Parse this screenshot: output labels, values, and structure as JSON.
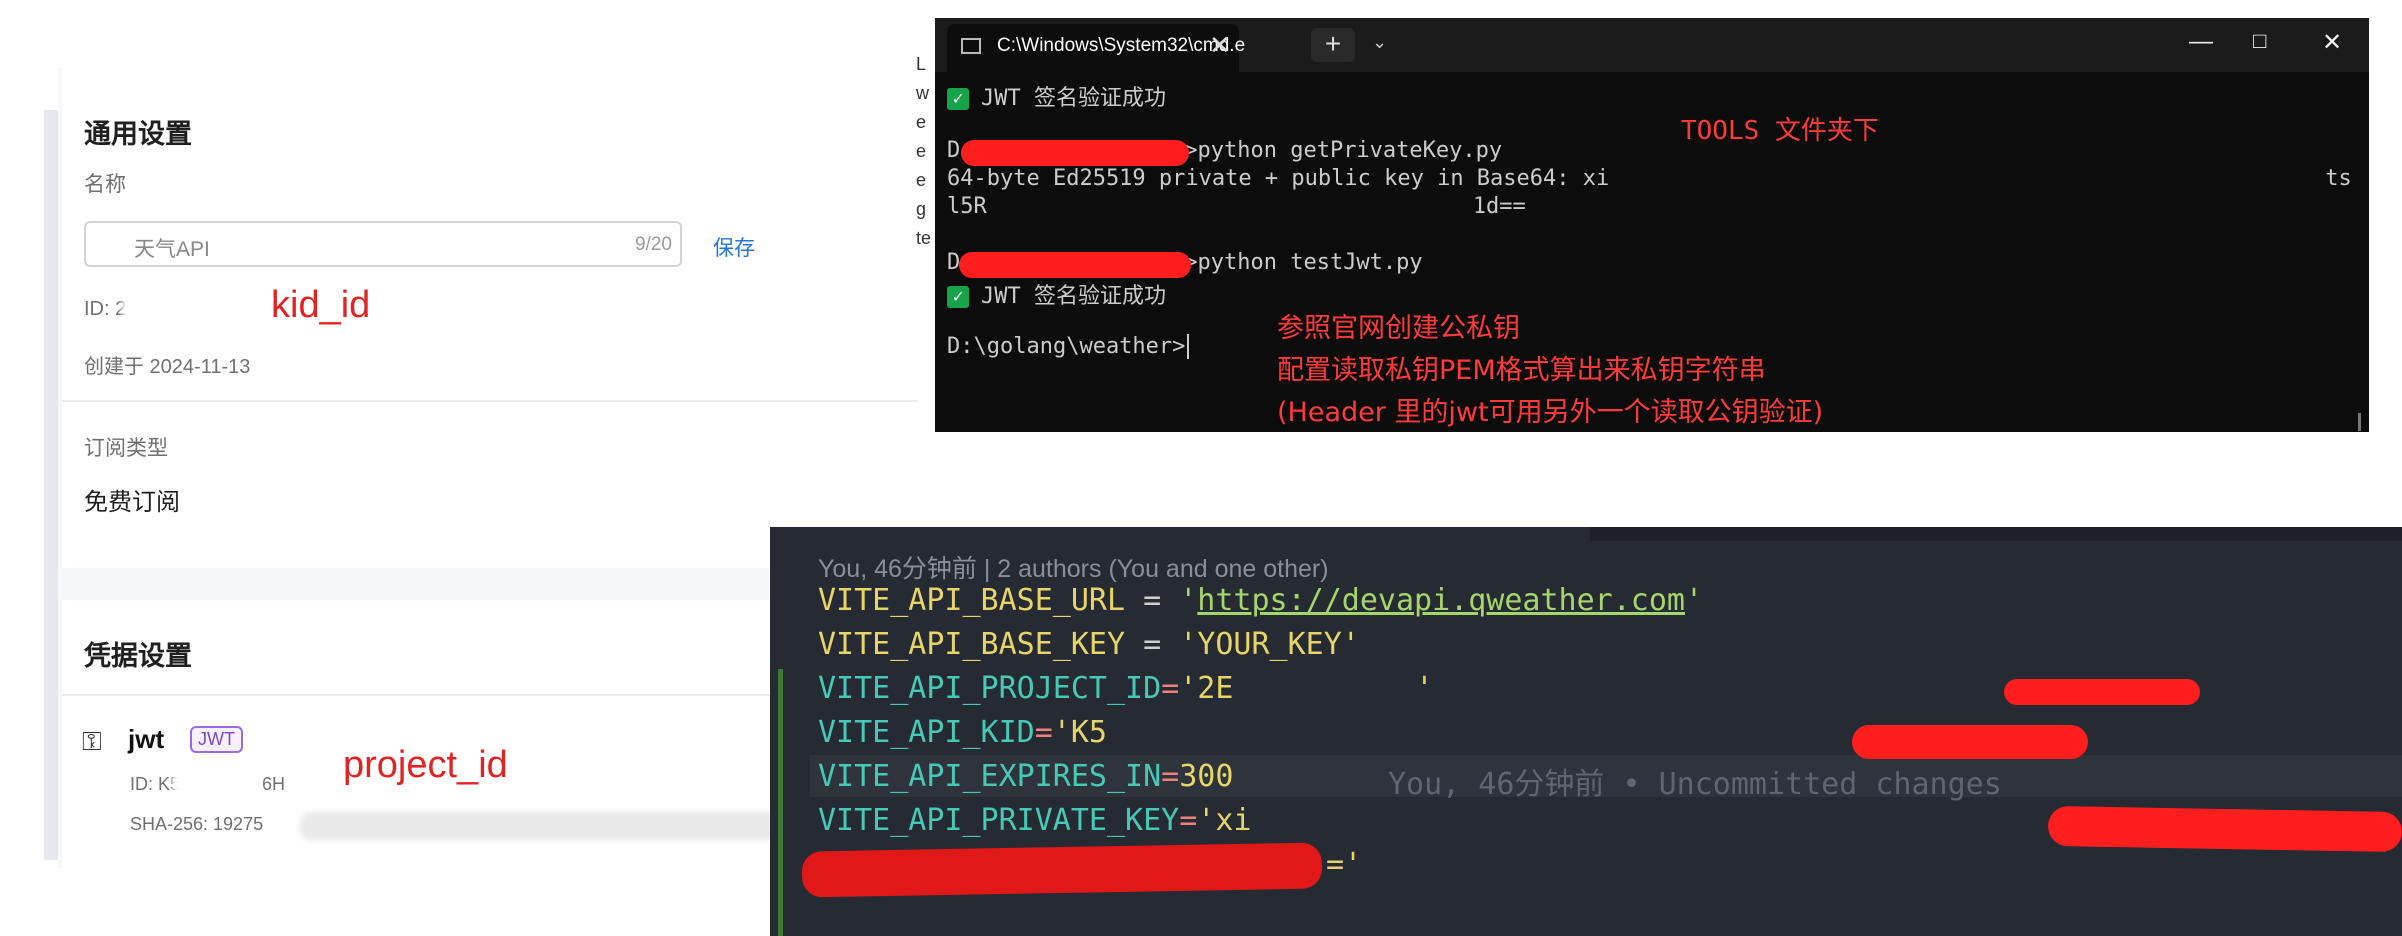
{
  "console": {
    "general_title": "通用设置",
    "name_label": "名称",
    "name_value": "天气API",
    "name_count": "9/20",
    "save_label": "保存",
    "id_text": "ID: 2E",
    "created_text": "创建于 2024-11-13",
    "subscription_label": "订阅类型",
    "subscription_value": "免费订阅",
    "credential_title": "凭据设置",
    "credential_name": "jwt",
    "credential_badge": "JWT",
    "credential_id": "ID: K5",
    "credential_id_tail": "6H",
    "credential_sha": "SHA-256: 19275"
  },
  "annotations": {
    "kid": "kid_id",
    "project": "project_id"
  },
  "cmd": {
    "tab_title": "C:\\Windows\\System32\\cmd.e",
    "strip_letters": [
      "L",
      "w",
      "e",
      "e",
      "e",
      "g",
      "te"
    ],
    "lines": {
      "ok1": "JWT 签名验证成功",
      "cmd1_suffix": ">python getPrivateKey.py",
      "out1_a": "64-byte Ed25519 private + public key in Base64: xi",
      "out1_b": "ts",
      "out2": "l5R",
      "out2_tail": "1d==",
      "cmd2_suffix": ">python testJwt.py",
      "ok2": "JWT 签名验证成功",
      "prompt": "D:\\golang\\weather>"
    },
    "tools_note": "TOOLS 文件夹下",
    "note_lines": [
      "参照官网创建公私钥",
      "配置读取私钥PEM格式算出来私钥字符串",
      "(Header 里的jwt可用另外一个读取公钥验证)"
    ]
  },
  "editor": {
    "blame": "You, 46分钟前 | 2 authors (You and one other)",
    "lines": [
      {
        "key": "VITE_API_BASE_URL",
        "eq": " = ",
        "quote": "'",
        "value": "https://devapi.qweather.com",
        "end": "'"
      },
      {
        "key": "VITE_API_BASE_KEY",
        "eq": " = ",
        "value": "'YOUR_KEY'"
      },
      {
        "key": "VITE_API_PROJECT_ID",
        "eq": "=",
        "value": "'2E",
        "end": "'"
      },
      {
        "key": "VITE_API_KID",
        "eq": "=",
        "value": "'K5"
      },
      {
        "key": "VITE_API_EXPIRES_IN",
        "eq": "=",
        "value": "300"
      },
      {
        "key": "VITE_API_PRIVATE_KEY",
        "eq": "=",
        "value": "'xi"
      }
    ],
    "last_line_end": "='",
    "ghost": "You, 46分钟前 • Uncommitted changes"
  }
}
